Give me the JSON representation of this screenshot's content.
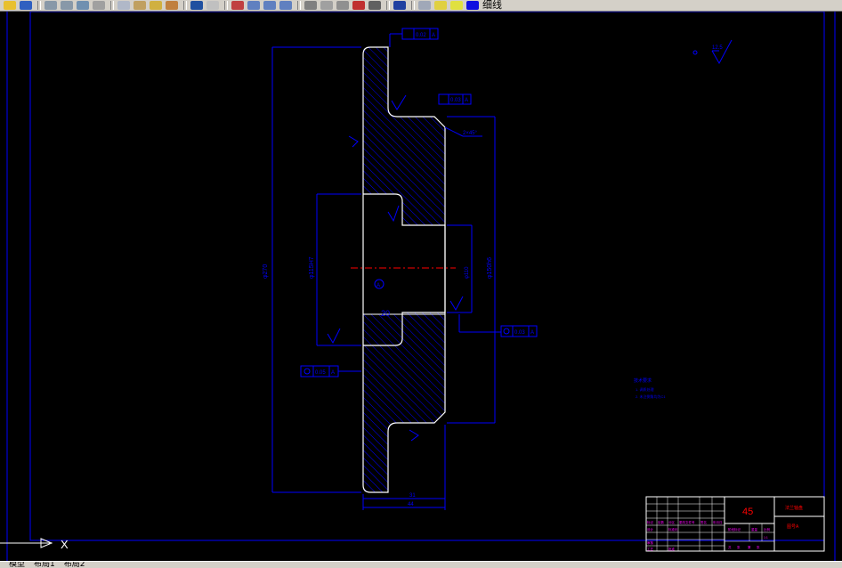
{
  "toolbar": {
    "layer_name": "细线",
    "button_icons": [
      "pen-icon",
      "save-icon",
      "print-icon",
      "print-preview-icon",
      "plot-icon",
      "cut-icon",
      "copy-icon",
      "paste-icon",
      "match-icon",
      "arrow-icon",
      "undo-icon",
      "redo-icon",
      "pan-icon",
      "zoom-realtime-icon",
      "zoom-window-icon",
      "zoom-prev-icon",
      "properties-icon",
      "design-center-icon",
      "tool-palette-icon",
      "calculator-icon",
      "table-icon",
      "help-icon",
      "layer-manager-icon",
      "layer-state-icon",
      "bulb-icon",
      "sun-icon",
      "lock-icon",
      "color-swatch-icon"
    ]
  },
  "drawing": {
    "datum_a_label": "A",
    "datum_top_flat": "0.02",
    "runout_right": "0.03",
    "runout_left": "0.05",
    "runout_bottom_right": "0.03",
    "chamfer_label": "2×45°",
    "bore_tol_label": "φ115H7",
    "outer_dia_label": "φ270",
    "hub_dia_label": "φ150h6",
    "bore_dim_label": "φ110",
    "dim_20": "20",
    "dim_bottom_1": "31",
    "dim_bottom_2": "44",
    "roughness_top_right": "12.5",
    "roughness_label_generic": "3.2",
    "tech_req_title": "技术要求",
    "tech_req_1": "1. 调质处理",
    "tech_req_2": "2. 未注倒角均为C1",
    "center_mark": "A"
  },
  "title_block": {
    "material": "45",
    "part_name": "法兰轴盘",
    "company": "图号A",
    "small_labels": [
      "标记",
      "处数",
      "分区",
      "更改文件号",
      "签名",
      "年月日",
      "设计",
      "标准化",
      "审核",
      "工艺",
      "批准",
      "阶段标记",
      "重量",
      "比例",
      "共",
      "张",
      "第",
      "张",
      "1:1"
    ]
  },
  "status": {
    "tab_model": "模型",
    "tab_layout1": "布局1",
    "tab_layout2": "布局2",
    "axis_x": "X"
  },
  "colors": {
    "border": "#0000ff",
    "geometry": "#ffffff",
    "hatch": "#0000ff",
    "centerline": "#ff0000",
    "title_red": "#ff0000",
    "title_magenta": "#ff00ff"
  }
}
